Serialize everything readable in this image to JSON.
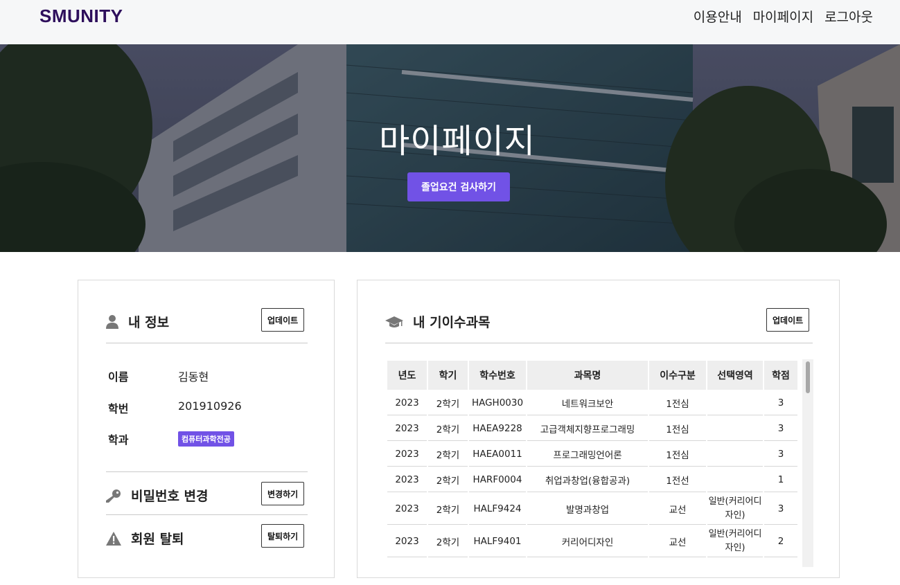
{
  "header": {
    "logo": "SMUNITY",
    "nav": [
      "이용안내",
      "마이페이지",
      "로그아웃"
    ]
  },
  "hero": {
    "title": "마이페이지",
    "button": "졸업요건 검사하기"
  },
  "profile": {
    "title": "내 정보",
    "update_button": "업데이트",
    "fields": [
      {
        "label": "이름",
        "value": "김동현"
      },
      {
        "label": "학번",
        "value": "201910926"
      },
      {
        "label": "학과",
        "value": "컴퓨터과학전공"
      }
    ],
    "password": {
      "title": "비밀번호 변경",
      "button": "변경하기"
    },
    "withdraw": {
      "title": "회원 탈퇴",
      "button": "탈퇴하기"
    }
  },
  "courses": {
    "title": "내 기이수과목",
    "update_button": "업데이트",
    "columns": [
      "년도",
      "학기",
      "학수번호",
      "과목명",
      "이수구분",
      "선택영역",
      "학점"
    ],
    "rows": [
      [
        "2023",
        "2학기",
        "HAGH0030",
        "네트워크보안",
        "1전심",
        "",
        "3"
      ],
      [
        "2023",
        "2학기",
        "HAEA9228",
        "고급객체지향프로그래밍",
        "1전심",
        "",
        "3"
      ],
      [
        "2023",
        "2학기",
        "HAEA0011",
        "프로그래밍언어론",
        "1전심",
        "",
        "3"
      ],
      [
        "2023",
        "2학기",
        "HARF0004",
        "취업과창업(융합공과)",
        "1전선",
        "",
        "1"
      ],
      [
        "2023",
        "2학기",
        "HALF9424",
        "발명과창업",
        "교선",
        "일반(커리어디자인)",
        "3"
      ],
      [
        "2023",
        "2학기",
        "HALF9401",
        "커리어디자인",
        "교선",
        "일반(커리어디자인)",
        "2"
      ]
    ]
  },
  "colors": {
    "accent": "#7152e6",
    "logo": "#2e0f5c"
  }
}
